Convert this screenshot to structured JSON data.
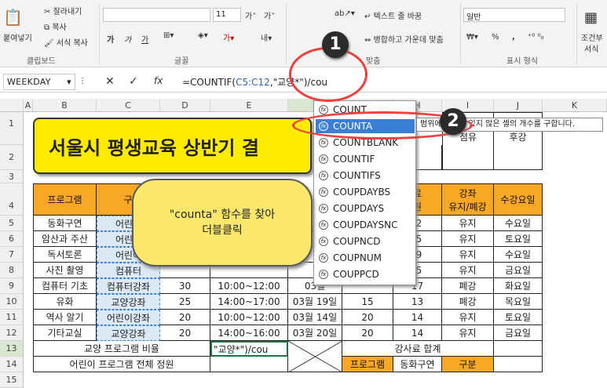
{
  "ribbon": {
    "clipboard": {
      "paste": "붙여넣기",
      "cut": "잘라내기",
      "copy": "복사",
      "format_painter": "서식 복사",
      "label": "클립보드"
    },
    "font": {
      "size": "11",
      "label": "글꼴",
      "bold": "가",
      "italic": "가",
      "underline": "가"
    },
    "alignment": {
      "wrap": "텍스트 줄 바꿈",
      "merge": "병합하고 가운데 맞춤",
      "label": "맞춤"
    },
    "number": {
      "format": "일반",
      "percent": "%",
      "comma": ",",
      "label": "표시 형식"
    },
    "styles": {
      "conditional": "조건부",
      "conditional2": "서식"
    }
  },
  "formula_bar": {
    "name_box": "WEEKDAY",
    "fx": "fx",
    "formula_prefix": "=COUNTIF(",
    "formula_ref": "C5:C12",
    "formula_suffix": ",\"교양*\")/cou"
  },
  "columns": [
    "A",
    "B",
    "C",
    "D",
    "E",
    "F",
    "G",
    "H",
    "I",
    "J",
    "K"
  ],
  "rows": [
    "1",
    "2",
    "3",
    "4",
    "5",
    "6",
    "7",
    "8",
    "9",
    "10",
    "11",
    "12",
    "13",
    "14",
    "15"
  ],
  "title": "서울시 평생교육 상반기 결",
  "table": {
    "headers": [
      "프로그램",
      "구",
      "",
      "",
      "",
      "료",
      "강좌",
      "수강요일"
    ],
    "header_sub": [
      "",
      "",
      "",
      "",
      "",
      "원",
      "유지/폐강",
      ""
    ],
    "top_right": {
      "h": "",
      "i": "점유",
      "j": "후강"
    },
    "rows": [
      {
        "program": "동화구연",
        "type": "어린이",
        "d": "",
        "e": "",
        "f": "",
        "g": "",
        "h": ".2",
        "i": "유지",
        "j": "수요일"
      },
      {
        "program": "암산과 주산",
        "type": "어린이",
        "d": "",
        "e": "",
        "f": "",
        "g": "",
        "h": ".5",
        "i": "유지",
        "j": "토요일"
      },
      {
        "program": "독서토론",
        "type": "어린이",
        "d": "",
        "e": "",
        "f": "",
        "g": "",
        "h": ".9",
        "i": "유지",
        "j": "수요일"
      },
      {
        "program": "사진 촬영",
        "type": "컴퓨터",
        "d": "",
        "e": "",
        "f": "",
        "g": "",
        "h": ".5",
        "i": "유지",
        "j": "금요일"
      },
      {
        "program": "컴퓨터 기초",
        "type": "컴퓨터강좌",
        "d": "30",
        "e": "10:00~12:00",
        "f": "03월",
        "g": "",
        "h": "17",
        "i": "폐강",
        "j": "화요일"
      },
      {
        "program": "유화",
        "type": "교양강좌",
        "d": "25",
        "e": "14:00~17:00",
        "f": "03월 19일",
        "g": "15",
        "h": "13",
        "i": "폐강",
        "j": "목요일"
      },
      {
        "program": "역사 알기",
        "type": "어린이강좌",
        "d": "20",
        "e": "10:00~12:00",
        "f": "03월 14일",
        "g": "20",
        "h": "14",
        "i": "유지",
        "j": "토요일"
      },
      {
        "program": "기타교실",
        "type": "교양강좌",
        "d": "20",
        "e": "14:00~16:00",
        "f": "03월 20일",
        "g": "20",
        "h": "14",
        "i": "유지",
        "j": "금요일"
      }
    ],
    "r13_label": "교양 프로그램 비율",
    "r13_formula": "\"교양*\")/cou",
    "r13_right": "강사료 합계",
    "r14_label": "어린이 프로그램 전체 정원",
    "r14_g": "프로그램",
    "r14_h": "동화구연",
    "r14_i": "구분"
  },
  "autocomplete": [
    "COUNT",
    "COUNTA",
    "COUNTBLANK",
    "COUNTIF",
    "COUNTIFS",
    "COUPDAYBS",
    "COUPDAYS",
    "COUPDAYSNC",
    "COUPNCD",
    "COUPNUM",
    "COUPPCD"
  ],
  "tooltip": "범위에서 비어 있지 않은 셀의 개수를 구합니다.",
  "callout_line1": "\"counta\"  함수를  찾아",
  "callout_line2": "더블클릭",
  "badge1": "1",
  "badge2": "2",
  "colors": {
    "header_orange": "#f9a825",
    "title_yellow": "#ffeb00",
    "callout_yellow": "#fbe86a",
    "highlight_blue": "#3a7fd4",
    "ring_red": "#ef4040"
  }
}
